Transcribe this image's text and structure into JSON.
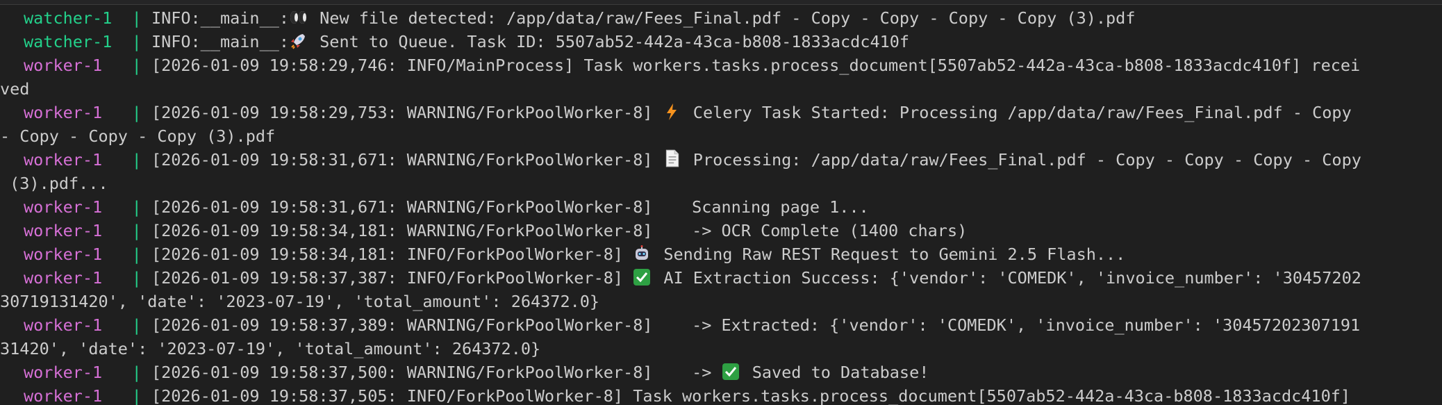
{
  "theme": {
    "background": "#1f1f1f",
    "text": "#cccccc",
    "watcher_color": "#23d18b",
    "worker_color": "#d670d6",
    "check_green": "#2ea043",
    "bolt_orange": "#f7931e"
  },
  "lines": [
    {
      "svc": "watcher-1 ",
      "pipe": " | ",
      "icon": "",
      "text": "INFO:__main__:",
      "icon2": "eyes-icon",
      "text2": " New file detected: /app/data/raw/Fees_Final.pdf - Copy - Copy - Copy - Copy (3).pdf"
    },
    {
      "svc": "watcher-1 ",
      "pipe": " | ",
      "icon": "",
      "text": "INFO:__main__:",
      "icon2": "rocket-icon",
      "text2": " Sent to Queue. Task ID: 5507ab52-442a-43ca-b808-1833acdc410f"
    },
    {
      "svc": "worker-1  ",
      "pipe": " | ",
      "text": "[2026-01-09 19:58:29,746: INFO/MainProcess] Task workers.tasks.process_document[5507ab52-442a-43ca-b808-1833acdc410f] recei"
    },
    {
      "cont": "ved"
    },
    {
      "svc": "worker-1  ",
      "pipe": " | ",
      "text": "[2026-01-09 19:58:29,753: WARNING/ForkPoolWorker-8] ",
      "icon2": "bolt-icon",
      "text2": " Celery Task Started: Processing /app/data/raw/Fees_Final.pdf - Copy"
    },
    {
      "cont": "- Copy - Copy - Copy (3).pdf"
    },
    {
      "svc": "worker-1  ",
      "pipe": " | ",
      "text": "[2026-01-09 19:58:31,671: WARNING/ForkPoolWorker-8] ",
      "icon2": "document-icon",
      "text2": " Processing: /app/data/raw/Fees_Final.pdf - Copy - Copy - Copy - Copy"
    },
    {
      "cont": " (3).pdf..."
    },
    {
      "svc": "worker-1  ",
      "pipe": " | ",
      "text": "[2026-01-09 19:58:31,671: WARNING/ForkPoolWorker-8]    Scanning page 1..."
    },
    {
      "svc": "worker-1  ",
      "pipe": " | ",
      "text": "[2026-01-09 19:58:34,181: WARNING/ForkPoolWorker-8]    -> OCR Complete (1400 chars)"
    },
    {
      "svc": "worker-1  ",
      "pipe": " | ",
      "text": "[2026-01-09 19:58:34,181: INFO/ForkPoolWorker-8] ",
      "icon2": "robot-icon",
      "text2": " Sending Raw REST Request to Gemini 2.5 Flash..."
    },
    {
      "svc": "worker-1  ",
      "pipe": " | ",
      "text": "[2026-01-09 19:58:37,387: INFO/ForkPoolWorker-8] ",
      "icon2": "check-icon",
      "text2": " AI Extraction Success: {'vendor': 'COMEDK', 'invoice_number': '30457202"
    },
    {
      "cont": "30719131420', 'date': '2023-07-19', 'total_amount': 264372.0}"
    },
    {
      "svc": "worker-1  ",
      "pipe": " | ",
      "text": "[2026-01-09 19:58:37,389: WARNING/ForkPoolWorker-8]    -> Extracted: {'vendor': 'COMEDK', 'invoice_number': '30457202307191"
    },
    {
      "cont": "31420', 'date': '2023-07-19', 'total_amount': 264372.0}"
    },
    {
      "svc": "worker-1  ",
      "pipe": " | ",
      "text": "[2026-01-09 19:58:37,500: WARNING/ForkPoolWorker-8]    -> ",
      "icon2": "check-icon",
      "text2": " Saved to Database!"
    },
    {
      "svc": "worker-1  ",
      "pipe": " | ",
      "text": "[2026-01-09 19:58:37,505: INFO/ForkPoolWorker-8] Task workers.tasks.process_document[5507ab52-442a-43ca-b808-1833acdc410f]"
    }
  ]
}
